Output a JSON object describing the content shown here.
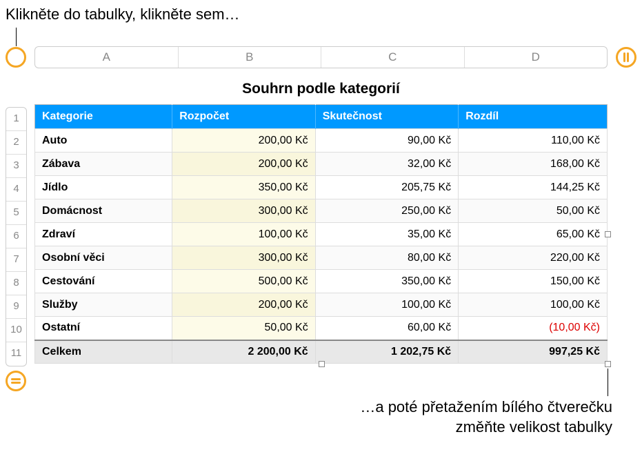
{
  "callouts": {
    "top": "Klikněte do tabulky, klikněte sem…",
    "bottom_line1": "…a poté přetažením bílého čtverečku",
    "bottom_line2": "změňte velikost tabulky"
  },
  "columns": [
    "A",
    "B",
    "C",
    "D"
  ],
  "rows": [
    "1",
    "2",
    "3",
    "4",
    "5",
    "6",
    "7",
    "8",
    "9",
    "10",
    "11"
  ],
  "table": {
    "title": "Souhrn podle kategorií",
    "headers": {
      "category": "Kategorie",
      "budget": "Rozpočet",
      "actual": "Skutečnost",
      "diff": "Rozdíl"
    },
    "data": [
      {
        "category": "Auto",
        "budget": "200,00 Kč",
        "actual": "90,00 Kč",
        "diff": "110,00 Kč",
        "neg": false
      },
      {
        "category": "Zábava",
        "budget": "200,00 Kč",
        "actual": "32,00 Kč",
        "diff": "168,00 Kč",
        "neg": false
      },
      {
        "category": "Jídlo",
        "budget": "350,00 Kč",
        "actual": "205,75 Kč",
        "diff": "144,25 Kč",
        "neg": false
      },
      {
        "category": "Domácnost",
        "budget": "300,00 Kč",
        "actual": "250,00 Kč",
        "diff": "50,00 Kč",
        "neg": false
      },
      {
        "category": "Zdraví",
        "budget": "100,00 Kč",
        "actual": "35,00 Kč",
        "diff": "65,00 Kč",
        "neg": false
      },
      {
        "category": "Osobní věci",
        "budget": "300,00 Kč",
        "actual": "80,00 Kč",
        "diff": "220,00 Kč",
        "neg": false
      },
      {
        "category": "Cestování",
        "budget": "500,00 Kč",
        "actual": "350,00 Kč",
        "diff": "150,00 Kč",
        "neg": false
      },
      {
        "category": "Služby",
        "budget": "200,00 Kč",
        "actual": "100,00 Kč",
        "diff": "100,00 Kč",
        "neg": false
      },
      {
        "category": "Ostatní",
        "budget": "50,00 Kč",
        "actual": "60,00 Kč",
        "diff": "(10,00 Kč)",
        "neg": true
      }
    ],
    "total": {
      "label": "Celkem",
      "budget": "2 200,00 Kč",
      "actual": "1 202,75 Kč",
      "diff": "997,25 Kč"
    }
  }
}
